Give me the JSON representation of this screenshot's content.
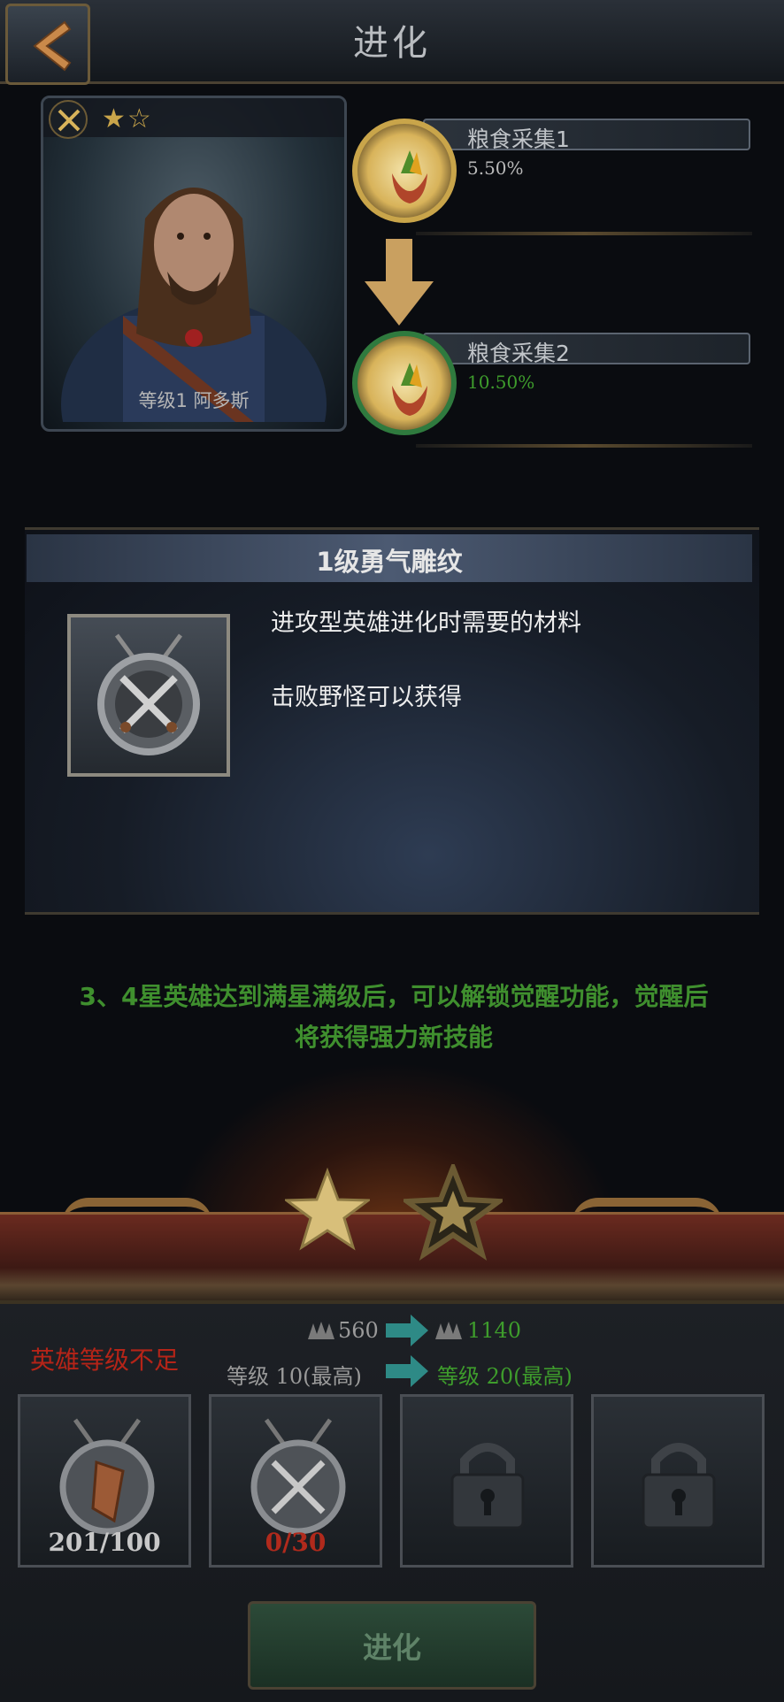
{
  "header": {
    "title": "进化"
  },
  "hero": {
    "stars": "★☆",
    "level_name": "等级1  阿多斯"
  },
  "skills": {
    "current": {
      "name": "粮食采集1",
      "percent": "5.50%"
    },
    "next": {
      "name": "粮食采集2",
      "percent": "10.50%"
    }
  },
  "material": {
    "title": "1级勇气雕纹",
    "desc1": "进攻型英雄进化时需要的材料",
    "desc2": "击败野怪可以获得"
  },
  "tip": {
    "line1": "3、4星英雄达到满星满级后，可以解锁觉醒功能，觉醒后",
    "line2": "将获得强力新技能"
  },
  "requirements": {
    "warning": "英雄等级不足",
    "power_from": "560",
    "power_to": "1140",
    "level_from": "等级 10(最高)",
    "level_to": "等级 20(最高)"
  },
  "slots": [
    {
      "count": "201/100",
      "color": "#c8c8c8"
    },
    {
      "count": "0/30",
      "color": "#b02a1c"
    }
  ],
  "evolve_button": {
    "label": "进化"
  },
  "colors": {
    "green": "#3e9c2c",
    "red": "#b52418",
    "gold": "#c9a54a"
  }
}
